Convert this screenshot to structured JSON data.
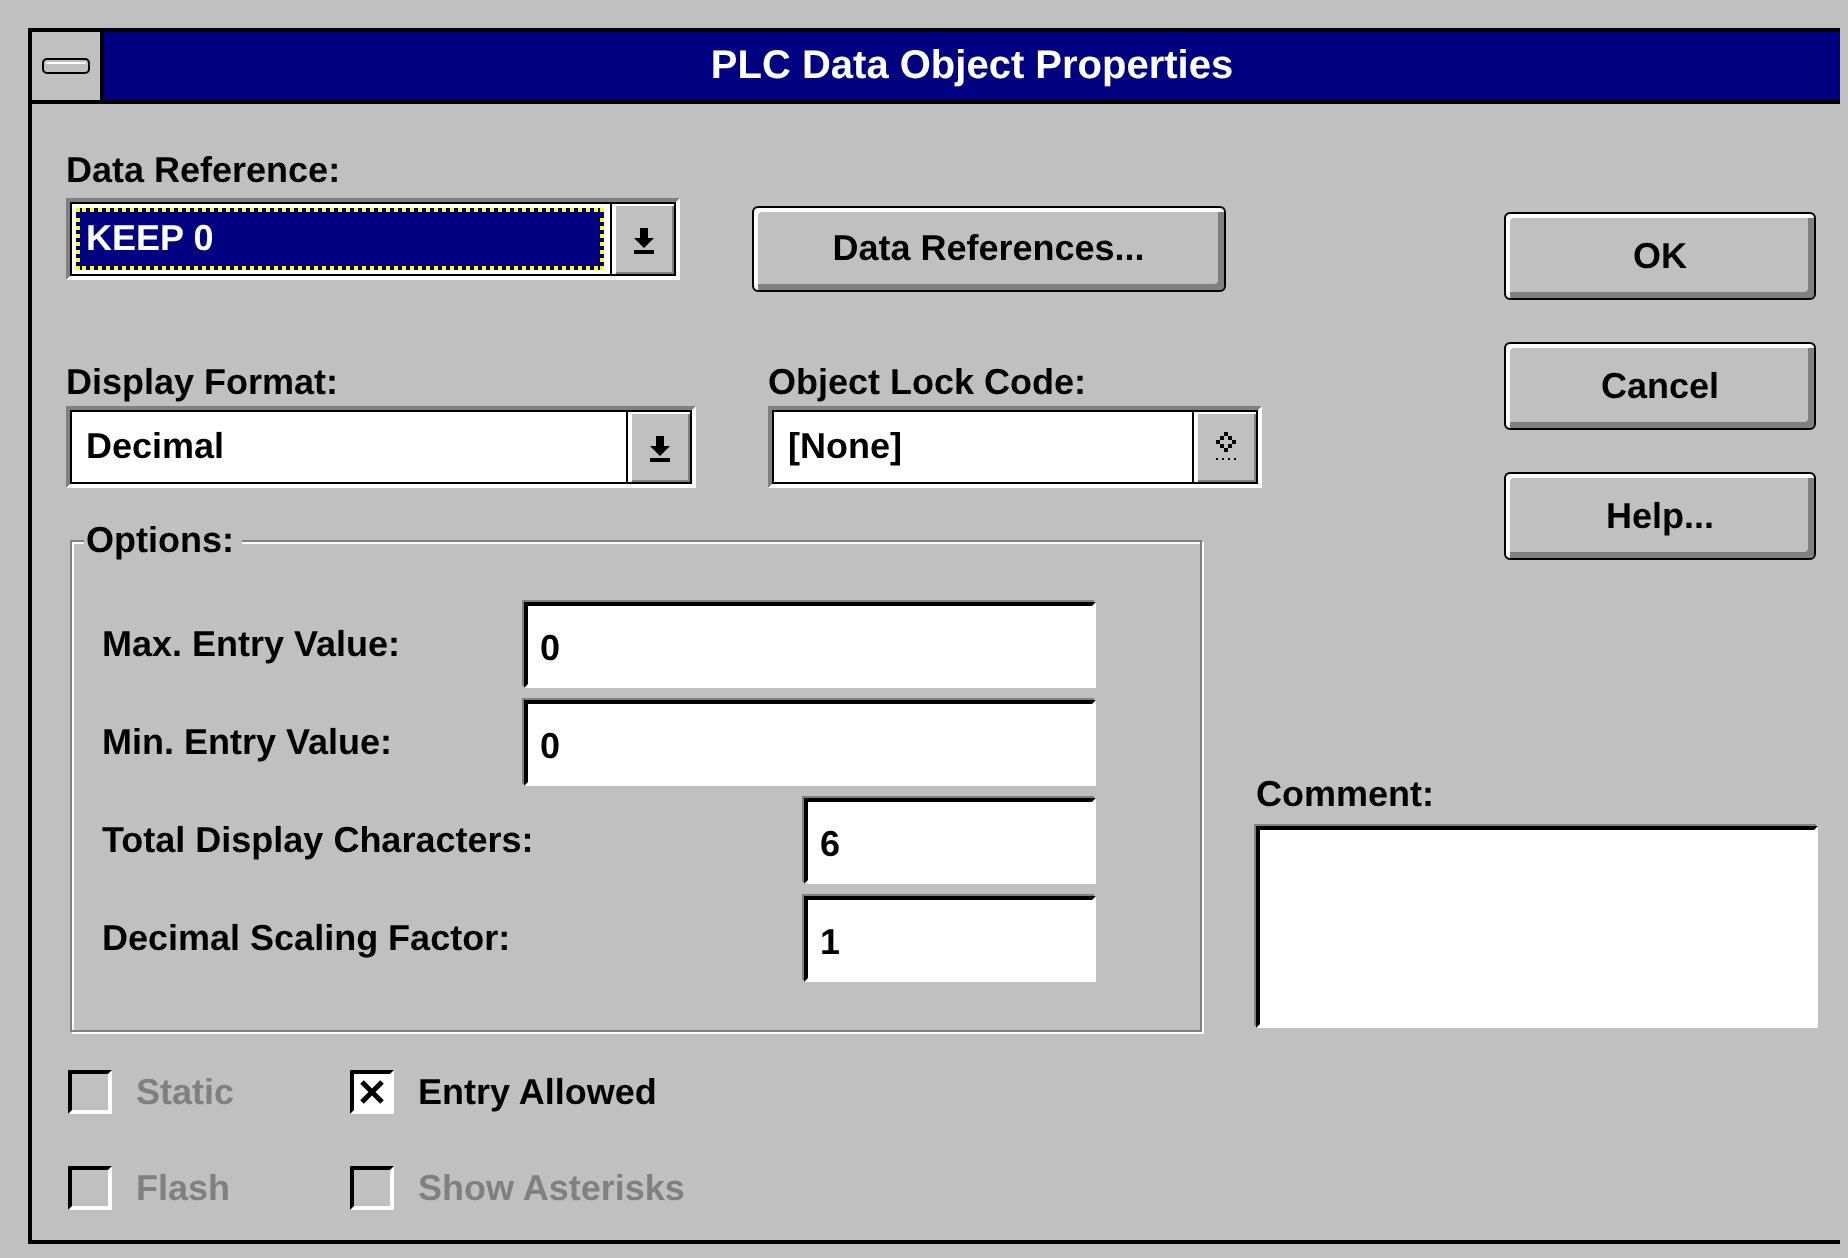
{
  "window": {
    "title": "PLC Data Object Properties"
  },
  "data_reference": {
    "label": "Data Reference:",
    "value": "KEEP 0",
    "selected": true
  },
  "data_references_button": {
    "label": "Data References..."
  },
  "display_format": {
    "label": "Display Format:",
    "value": "Decimal",
    "selected": false
  },
  "object_lock_code": {
    "label": "Object Lock Code:",
    "value": "[None]"
  },
  "buttons": [
    {
      "label": "OK"
    },
    {
      "label": "Cancel"
    },
    {
      "label": "Help..."
    }
  ],
  "options": {
    "title": "Options:",
    "fields": [
      {
        "label": "Max. Entry Value:",
        "value": "0",
        "kind": "wide"
      },
      {
        "label": "Min. Entry Value:",
        "value": "0",
        "kind": "wide"
      },
      {
        "label": "Total Display Characters:",
        "value": "6",
        "kind": "narrow"
      },
      {
        "label": "Decimal Scaling Factor:",
        "value": "1",
        "kind": "narrow"
      }
    ]
  },
  "comment": {
    "label": "Comment:"
  },
  "checkboxes": [
    {
      "label": "Static",
      "checked": false,
      "disabled": true
    },
    {
      "label": "Entry Allowed",
      "checked": true,
      "disabled": false
    },
    {
      "label": "Flash",
      "checked": false,
      "disabled": true
    },
    {
      "label": "Show Asterisks",
      "checked": false,
      "disabled": true
    }
  ]
}
